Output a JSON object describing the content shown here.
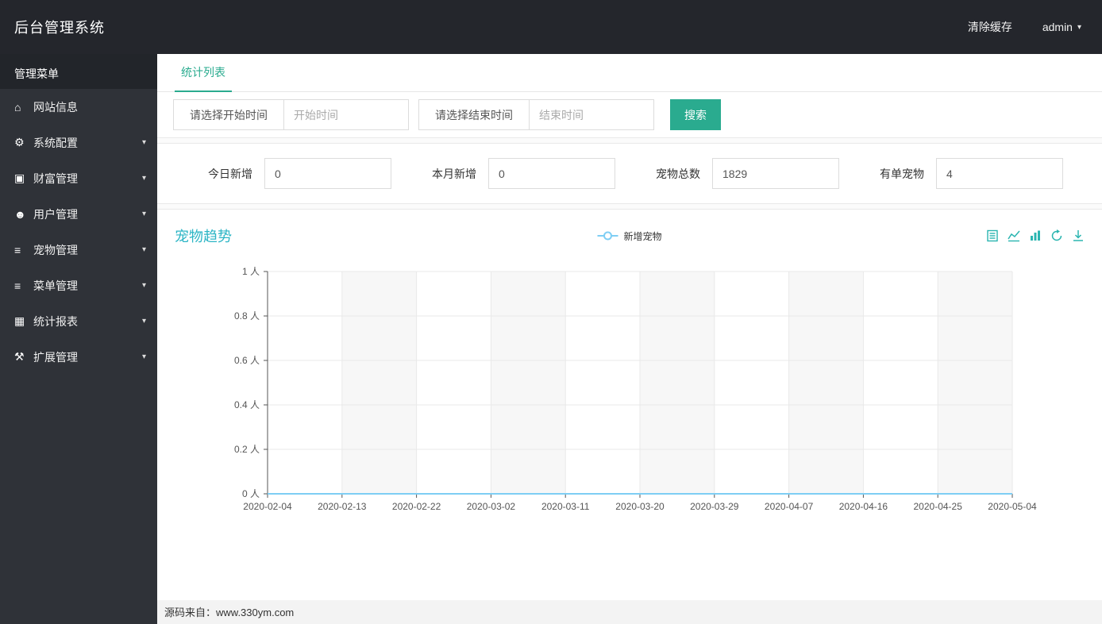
{
  "topbar": {
    "title": "后台管理系统",
    "clear_cache": "清除缓存",
    "user": "admin"
  },
  "icons": {
    "caret_down": "caret-down-icon"
  },
  "sidebar": {
    "header": "管理菜单",
    "items": [
      {
        "label": "网站信息",
        "icon": "home-icon",
        "has_submenu": false
      },
      {
        "label": "系统配置",
        "icon": "gears-icon",
        "has_submenu": true
      },
      {
        "label": "财富管理",
        "icon": "wealth-icon",
        "has_submenu": true
      },
      {
        "label": "用户管理",
        "icon": "users-icon",
        "has_submenu": true
      },
      {
        "label": "宠物管理",
        "icon": "list-icon",
        "has_submenu": true
      },
      {
        "label": "菜单管理",
        "icon": "list-icon",
        "has_submenu": true
      },
      {
        "label": "统计报表",
        "icon": "report-icon",
        "has_submenu": true
      },
      {
        "label": "扩展管理",
        "icon": "wrench-icon",
        "has_submenu": true
      }
    ]
  },
  "tabs": {
    "active": "统计列表"
  },
  "filter": {
    "start_button": "请选择开始时间",
    "start_placeholder": "开始时间",
    "end_button": "请选择结束时间",
    "end_placeholder": "结束时间",
    "search_button": "搜索"
  },
  "stats": {
    "fields": [
      {
        "label": "今日新增",
        "value": "0"
      },
      {
        "label": "本月新增",
        "value": "0"
      },
      {
        "label": "宠物总数",
        "value": "1829"
      },
      {
        "label": "有单宠物",
        "value": "4"
      }
    ]
  },
  "chart_section": {
    "title": "宠物趋势",
    "legend": "新增宠物",
    "toolbox": [
      "dataview-icon",
      "line-chart-icon",
      "bar-chart-icon",
      "refresh-icon",
      "download-icon"
    ]
  },
  "chart_data": {
    "type": "line",
    "title": "宠物趋势",
    "legend": [
      "新增宠物"
    ],
    "legend_position": "top-center",
    "categories": [
      "2020-02-04",
      "2020-02-13",
      "2020-02-22",
      "2020-03-02",
      "2020-03-11",
      "2020-03-20",
      "2020-03-29",
      "2020-04-07",
      "2020-04-16",
      "2020-04-25",
      "2020-05-04"
    ],
    "series": [
      {
        "name": "新增宠物",
        "values": [
          0,
          0,
          0,
          0,
          0,
          0,
          0,
          0,
          0,
          0,
          0
        ]
      }
    ],
    "xlabel": "",
    "ylabel": "",
    "ylim": [
      0,
      1
    ],
    "y_ticks": [
      0,
      0.2,
      0.4,
      0.6,
      0.8,
      1
    ],
    "y_tick_labels": [
      "0 人",
      "0.2 人",
      "0.4 人",
      "0.6 人",
      "0.8 人",
      "1 人"
    ],
    "grid": true,
    "split_area_alternating": true
  },
  "footer": {
    "text": "源码来自：www.330ym.com"
  },
  "colors": {
    "accent": "#2aab8f",
    "chart_title": "#2cb5c5",
    "line": "#7ecef4",
    "topbar_bg": "#24262c",
    "sidebar_bg": "#2f3238",
    "sidebar_header_bg": "#22252a",
    "grid_line": "#e9e9e9",
    "axis_line": "#555555",
    "split_area": "#f7f7f7"
  }
}
